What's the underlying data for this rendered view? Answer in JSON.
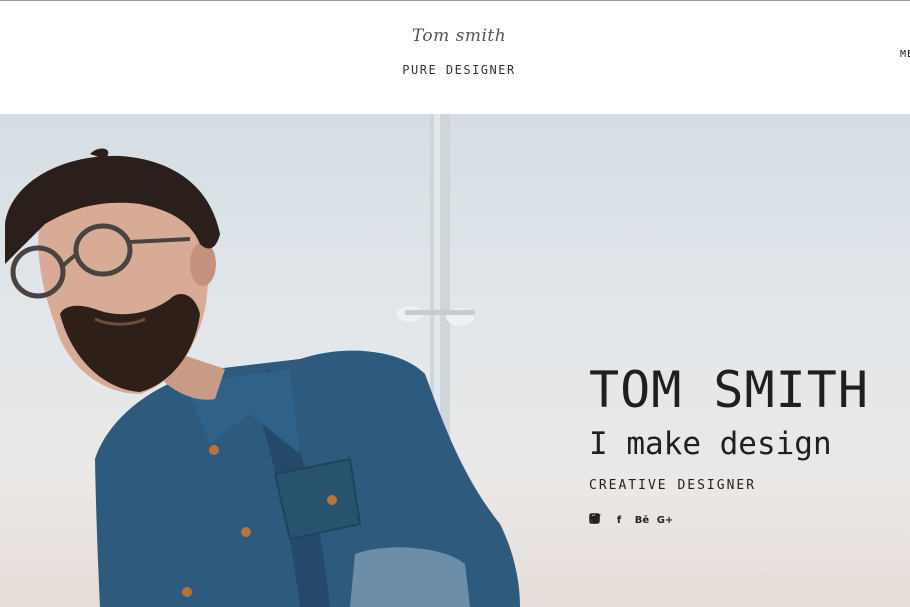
{
  "header": {
    "logo_text": "Tom smith",
    "tagline": "PURE DESIGNER",
    "menu_label": "MENU"
  },
  "hero": {
    "name": "TOM SMITH",
    "tagline": "I make design",
    "role": "CREATIVE DESIGNER",
    "social": [
      {
        "icon": "twitter-icon",
        "glyph": ""
      },
      {
        "icon": "facebook-icon",
        "glyph": "f"
      },
      {
        "icon": "behance-icon",
        "glyph": "Bē"
      },
      {
        "icon": "google-plus-icon",
        "glyph": "G+"
      },
      {
        "icon": "dribbble-icon",
        "glyph": ""
      },
      {
        "icon": "instagram-icon",
        "glyph": ""
      }
    ]
  },
  "colors": {
    "text": "#222222",
    "sky": "#dde3e7",
    "shirt": "#2d5a7d",
    "hair": "#2a1f1a"
  }
}
